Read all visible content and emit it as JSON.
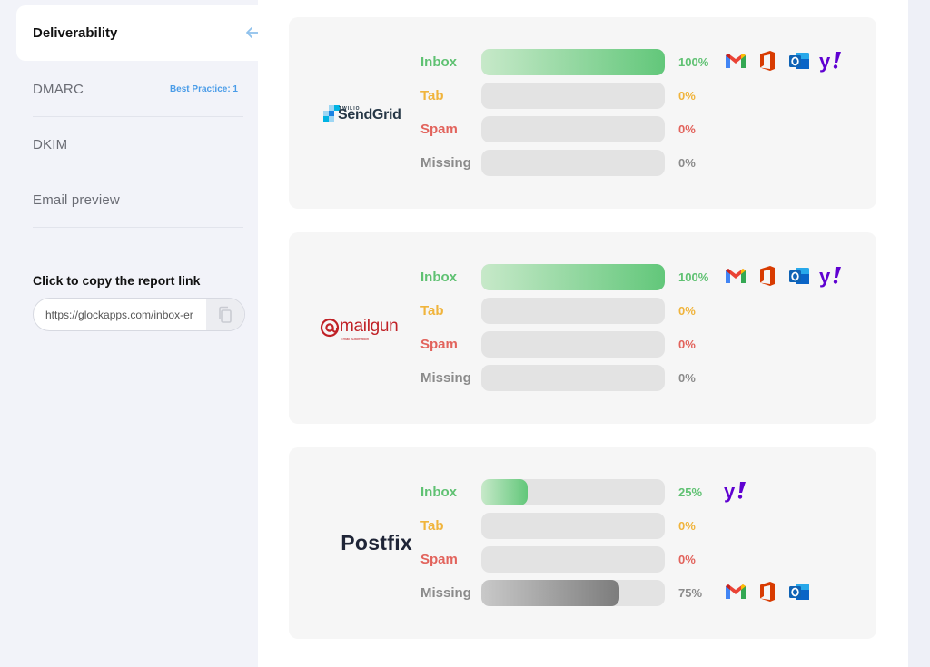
{
  "sidebar": {
    "active": {
      "label": "Deliverability"
    },
    "items": [
      {
        "label": "DMARC",
        "badge": "Best Practice: 1"
      },
      {
        "label": "DKIM",
        "badge": ""
      },
      {
        "label": "Email preview",
        "badge": ""
      }
    ],
    "copy": {
      "title": "Click to copy the report link",
      "value": "https://glockapps.com/inbox-er"
    }
  },
  "colors": {
    "inbox": "#5fc172",
    "tab": "#f0b43c",
    "spam": "#e2635c",
    "missing": "#8b8b8b",
    "link_badge": "#4a9ce8"
  },
  "providers": [
    {
      "name": "SendGrid",
      "prefix": "TWILIO",
      "rows": [
        {
          "label": "Inbox",
          "value": 100,
          "pct": "100%",
          "icons": [
            "gmail-icon",
            "office-icon",
            "outlook-icon",
            "yahoo-icon"
          ]
        },
        {
          "label": "Tab",
          "value": 0,
          "pct": "0%",
          "icons": []
        },
        {
          "label": "Spam",
          "value": 0,
          "pct": "0%",
          "icons": []
        },
        {
          "label": "Missing",
          "value": 0,
          "pct": "0%",
          "icons": []
        }
      ]
    },
    {
      "name": "mailgun",
      "subtitle": "Email Automation",
      "rows": [
        {
          "label": "Inbox",
          "value": 100,
          "pct": "100%",
          "icons": [
            "gmail-icon",
            "office-icon",
            "outlook-icon",
            "yahoo-icon"
          ]
        },
        {
          "label": "Tab",
          "value": 0,
          "pct": "0%",
          "icons": []
        },
        {
          "label": "Spam",
          "value": 0,
          "pct": "0%",
          "icons": []
        },
        {
          "label": "Missing",
          "value": 0,
          "pct": "0%",
          "icons": []
        }
      ]
    },
    {
      "name": "Postfix",
      "rows": [
        {
          "label": "Inbox",
          "value": 25,
          "pct": "25%",
          "icons": [
            "yahoo-icon"
          ]
        },
        {
          "label": "Tab",
          "value": 0,
          "pct": "0%",
          "icons": []
        },
        {
          "label": "Spam",
          "value": 0,
          "pct": "0%",
          "icons": []
        },
        {
          "label": "Missing",
          "value": 75,
          "pct": "75%",
          "icons": [
            "gmail-icon",
            "office-icon",
            "outlook-icon"
          ]
        }
      ]
    }
  ]
}
